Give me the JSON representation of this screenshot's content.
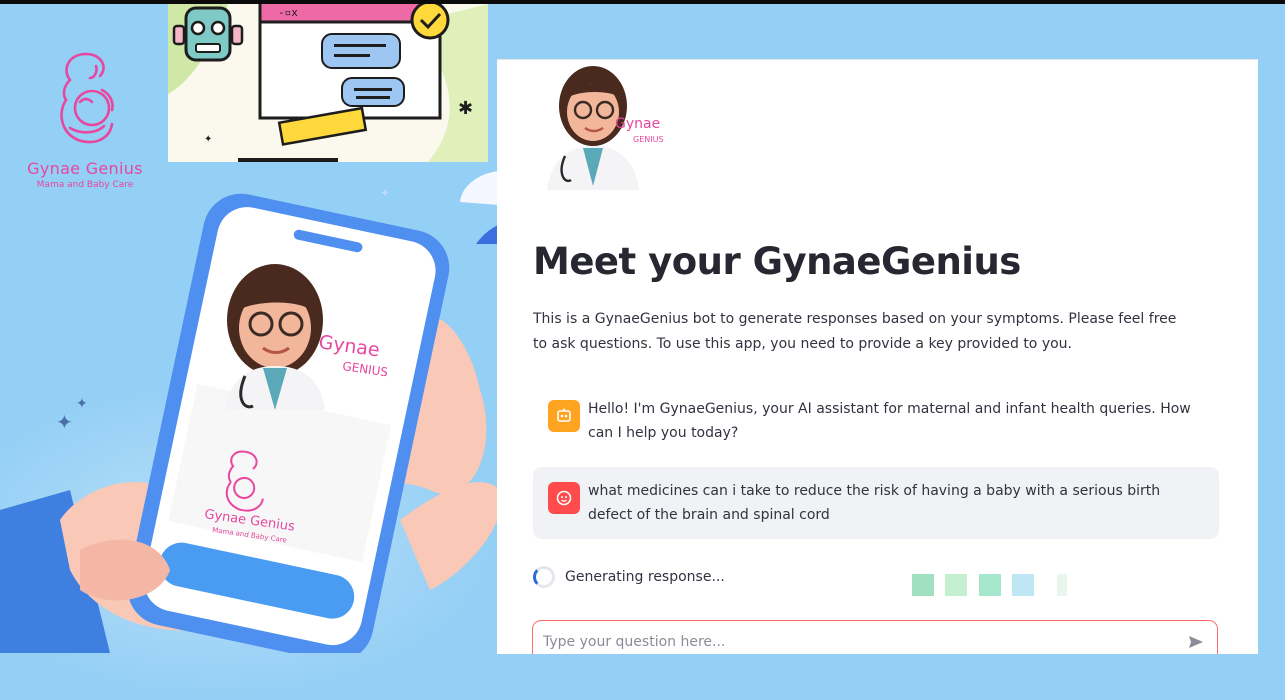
{
  "logo": {
    "title": "Gynae Genius",
    "subtitle": "Mama and Baby Care",
    "icon": "mother-baby-icon",
    "color": "#e8479f"
  },
  "phone_screen": {
    "brand_top": "Gynae",
    "brand_bottom": "GENIUS",
    "logo_title": "Gynae Genius",
    "logo_subtitle": "Mama and Baby Care"
  },
  "panel": {
    "avatar_brand_top": "Gynae",
    "avatar_brand_bottom": "GENIUS",
    "title": "Meet your GynaeGenius",
    "intro": "This is a GynaeGenius bot to generate responses based on your symptoms. Please feel free to ask questions. To use this app, you need to provide a key provided to you.",
    "messages": [
      {
        "role": "assistant",
        "icon": "robot-icon",
        "text": "Hello! I'm GynaeGenius, your AI assistant for maternal and infant health queries. How can I help you today?"
      },
      {
        "role": "user",
        "icon": "user-face-icon",
        "text": "what medicines can i take to reduce the risk of having a baby with a serious birth defect of the brain and spinal cord"
      }
    ],
    "status": "Generating response...",
    "input_placeholder": "Type your question here...",
    "send_icon": "send-icon"
  },
  "colors": {
    "background": "#94cff5",
    "assistant_avatar": "#ffa421",
    "user_avatar": "#ff4b4b",
    "input_border": "#ff6b6b",
    "brand_pink": "#e8479f"
  }
}
